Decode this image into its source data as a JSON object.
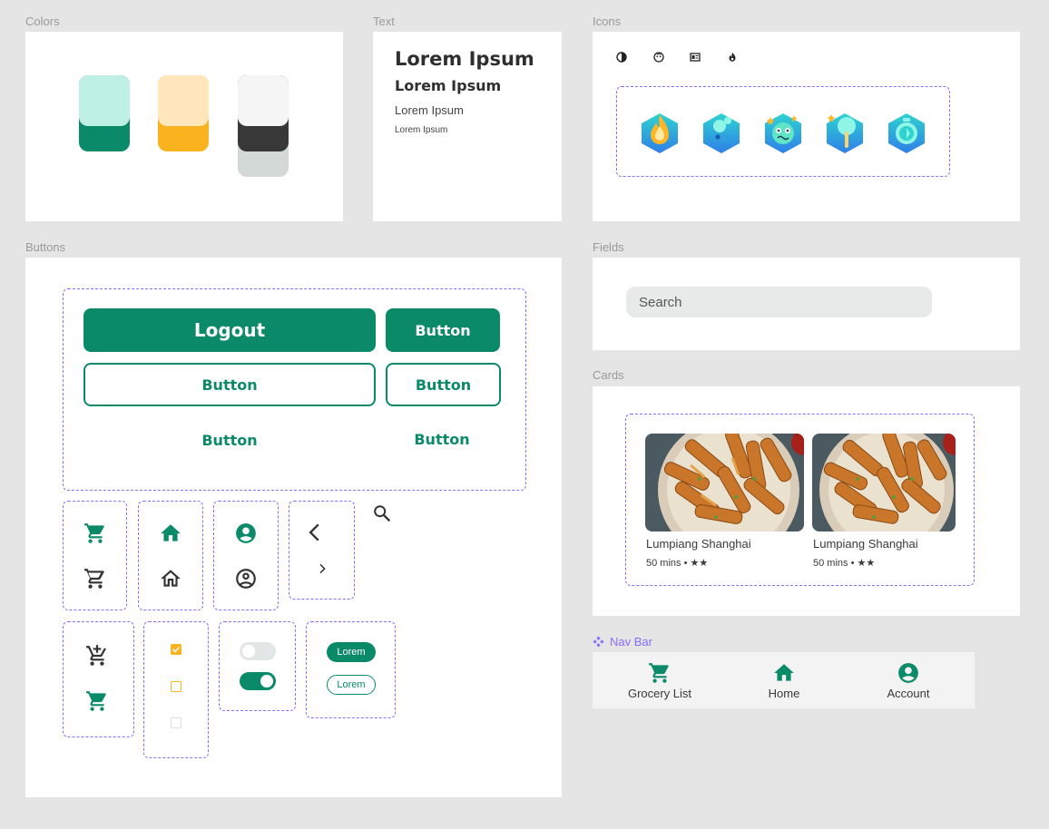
{
  "sections": {
    "colors": "Colors",
    "text": "Text",
    "icons": "Icons",
    "buttons": "Buttons",
    "fields": "Fields",
    "cards": "Cards",
    "navbar": "Nav Bar"
  },
  "palette": {
    "primary_light": "#bff0e6",
    "primary": "#0b8a6a",
    "accent_light": "#ffe6bb",
    "accent": "#fbb21f",
    "neutral_light": "#f5f5f5",
    "neutral_dark": "#383838",
    "neutral_gray": "#d2d9d7",
    "selection_dash": "#8a6cff"
  },
  "text_samples": {
    "h1": "Lorem Ipsum",
    "h2": "Lorem Ipsum",
    "body": "Lorem Ipsum",
    "caption": "Lorem Ipsum"
  },
  "icons": {
    "small": [
      "contrast-icon",
      "face-icon",
      "document-icon",
      "flame-icon"
    ],
    "badges": [
      "fire-badge-icon",
      "drop-badge-icon",
      "monster-badge-icon",
      "lollipop-badge-icon",
      "timer-badge-icon"
    ]
  },
  "buttons": {
    "logout": "Logout",
    "filled_small": "Button",
    "outline_large": "Button",
    "outline_small": "Button",
    "text_large": "Button",
    "text_small": "Button"
  },
  "chips": {
    "filled": "Lorem",
    "outline": "Lorem"
  },
  "fields": {
    "search_placeholder": "Search"
  },
  "cards": [
    {
      "title": "Lumpiang Shanghai",
      "meta": "50 mins • ★★"
    },
    {
      "title": "Lumpiang Shanghai",
      "meta": "50 mins • ★★"
    }
  ],
  "navbar": {
    "items": [
      {
        "label": "Grocery List",
        "icon": "cart-icon"
      },
      {
        "label": "Home",
        "icon": "home-icon"
      },
      {
        "label": "Account",
        "icon": "account-icon"
      }
    ]
  }
}
